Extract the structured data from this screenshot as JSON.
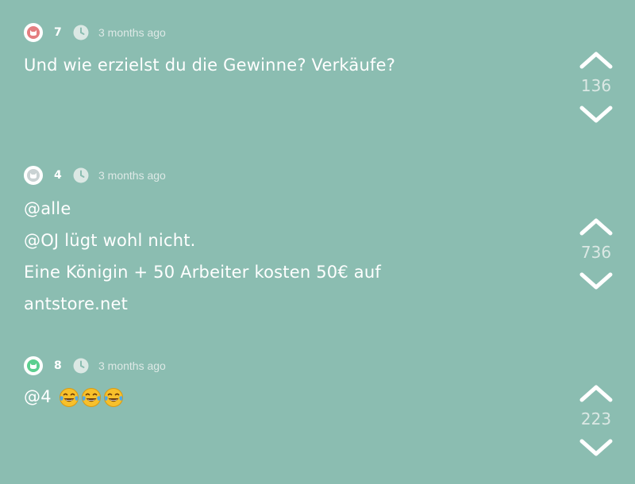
{
  "colors": {
    "background": "#8bbdb1",
    "avatar_red": "#e47e80",
    "avatar_gray": "#c9d2d3",
    "avatar_green": "#5bcf8f"
  },
  "posts": [
    {
      "author": "7",
      "time": "3 months ago",
      "avatar_color": "avatar_red",
      "lines": [
        "Und wie erzielst du die Gewinne? Verkäufe?"
      ],
      "votes": "136"
    },
    {
      "author": "4",
      "time": "3 months ago",
      "avatar_color": "avatar_gray",
      "lines": [
        "@alle",
        "@OJ lügt wohl nicht.",
        "Eine Königin + 50 Arbeiter kosten 50€ auf",
        "antstore.net"
      ],
      "votes": "736"
    },
    {
      "author": "8",
      "time": "3 months ago",
      "avatar_color": "avatar_green",
      "lines": [
        "@4"
      ],
      "emoji": "face-with-tears-of-joy",
      "emoji_count": 3,
      "votes": "223"
    }
  ]
}
